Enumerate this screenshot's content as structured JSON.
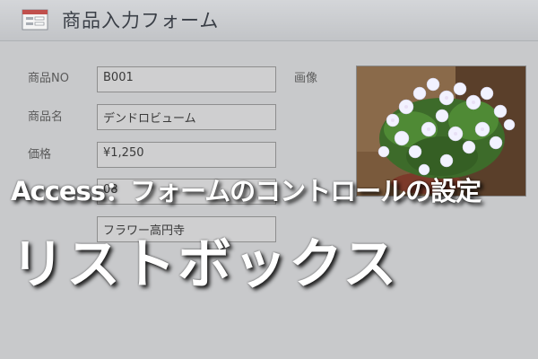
{
  "window": {
    "title": "商品入力フォーム",
    "icon": "form-icon"
  },
  "form": {
    "fields": [
      {
        "label": "商品NO",
        "value": "B001"
      },
      {
        "label": "商品名",
        "value": "デンドロビューム"
      },
      {
        "label": "価格",
        "value": "¥1,250"
      },
      {
        "label": "",
        "value": "08"
      },
      {
        "label": "",
        "value": "フラワー高円寺"
      }
    ],
    "image_label": "画像"
  },
  "overlay": {
    "subtitle": "Access：フォームのコントロールの設定",
    "title": "リストボックス"
  },
  "colors": {
    "background": "#c8c9cb",
    "titlebar": "#c8cacd",
    "text": "#3a3f47"
  }
}
